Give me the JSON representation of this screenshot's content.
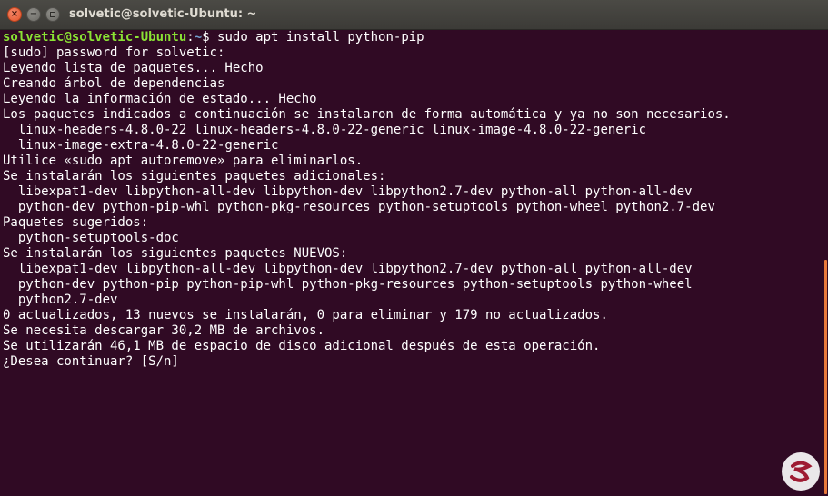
{
  "window": {
    "title": "solvetic@solvetic-Ubuntu: ~",
    "close_icon": "×",
    "minimize_icon": "−"
  },
  "terminal": {
    "prompt_user": "solvetic@solvetic-Ubuntu",
    "prompt_sep": ":",
    "prompt_path": "~",
    "prompt_symbol": "$ ",
    "command": "sudo apt install python-pip",
    "lines": [
      "[sudo] password for solvetic:",
      "Leyendo lista de paquetes... Hecho",
      "Creando árbol de dependencias",
      "Leyendo la información de estado... Hecho",
      "Los paquetes indicados a continuación se instalaron de forma automática y ya no son necesarios.",
      "  linux-headers-4.8.0-22 linux-headers-4.8.0-22-generic linux-image-4.8.0-22-generic",
      "  linux-image-extra-4.8.0-22-generic",
      "Utilice «sudo apt autoremove» para eliminarlos.",
      "Se instalarán los siguientes paquetes adicionales:",
      "  libexpat1-dev libpython-all-dev libpython-dev libpython2.7-dev python-all python-all-dev",
      "  python-dev python-pip-whl python-pkg-resources python-setuptools python-wheel python2.7-dev",
      "Paquetes sugeridos:",
      "  python-setuptools-doc",
      "Se instalarán los siguientes paquetes NUEVOS:",
      "  libexpat1-dev libpython-all-dev libpython-dev libpython2.7-dev python-all python-all-dev",
      "  python-dev python-pip python-pip-whl python-pkg-resources python-setuptools python-wheel",
      "  python2.7-dev",
      "0 actualizados, 13 nuevos se instalarán, 0 para eliminar y 179 no actualizados.",
      "Se necesita descargar 30,2 MB de archivos.",
      "Se utilizarán 46,1 MB de espacio de disco adicional después de esta operación.",
      "¿Desea continuar? [S/n]"
    ]
  },
  "colors": {
    "terminal_bg": "#300a24",
    "prompt_user": "#8ae234",
    "prompt_path": "#729fcf",
    "scroll_thumb": "#e9793b",
    "close_button": "#e1542a"
  },
  "icons": {
    "close": "close-icon",
    "minimize": "minimize-icon",
    "maximize": "maximize-icon",
    "watermark": "solvetic-logo-icon"
  }
}
